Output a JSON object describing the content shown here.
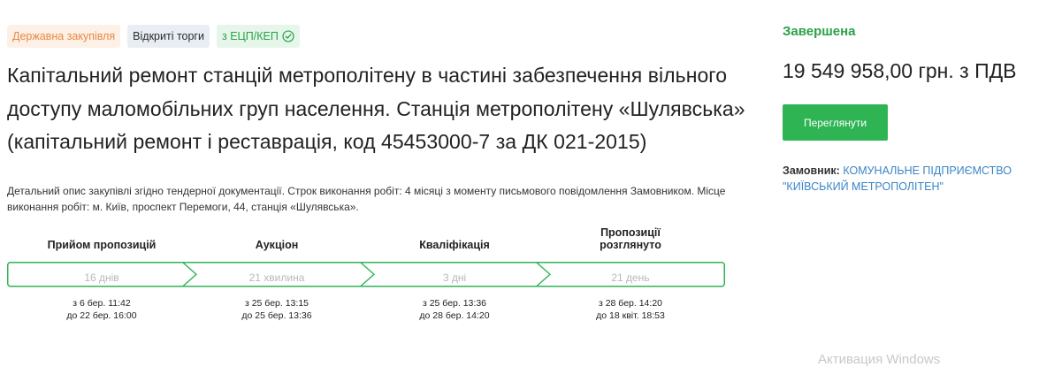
{
  "badges": {
    "procurement_type": "Державна закупівля",
    "trade_type": "Відкриті торги",
    "signature": "з ЕЦП/КЕП"
  },
  "tender": {
    "title": "Капітальний ремонт станцій метрополітену в частині забезпечення вільного доступу маломобільних груп населення. Станція метрополітену «Шулявська» (капітальний ремонт і реставрація, код 45453000-7 за ДК 021-2015)",
    "description": "Детальний опис закупівлі згідно тендерної документації. Строк виконання робіт: 4 місяці з моменту письмового повідомлення Замовником. Місце виконання робіт: м. Київ, проспект Перемоги, 44, станція «Шулявська»."
  },
  "stages": [
    {
      "title": "Прийом пропозицій",
      "duration": "16 днів",
      "from": "з 6 бер. 11:42",
      "to": "до 22 бер. 16:00"
    },
    {
      "title": "Аукціон",
      "duration": "21 хвилина",
      "from": "з 25 бер. 13:15",
      "to": "до 25 бер. 13:36"
    },
    {
      "title": "Кваліфікація",
      "duration": "3 дні",
      "from": "з 25 бер. 13:36",
      "to": "до 28 бер. 14:20"
    },
    {
      "title_line1": "Пропозиції",
      "title_line2": "розглянуто",
      "duration": "21 день",
      "from": "з 28 бер. 14:20",
      "to": "до 18 квіт. 18:53"
    }
  ],
  "sidebar": {
    "status": "Завершена",
    "price": "19 549 958,00 грн. з ПДВ",
    "view_button": "Переглянути",
    "customer_label": "Замовник:",
    "customer_name": "КОМУНАЛЬНЕ ПІДПРИЄМСТВО \"КИЇВСЬКИЙ МЕТРОПОЛІТЕН\""
  },
  "os_watermark": "Активация Windows",
  "colors": {
    "accent_green": "#2fb454",
    "status_green": "#2aa147",
    "link_blue": "#3a85c6",
    "badge_orange": "#e98943"
  }
}
